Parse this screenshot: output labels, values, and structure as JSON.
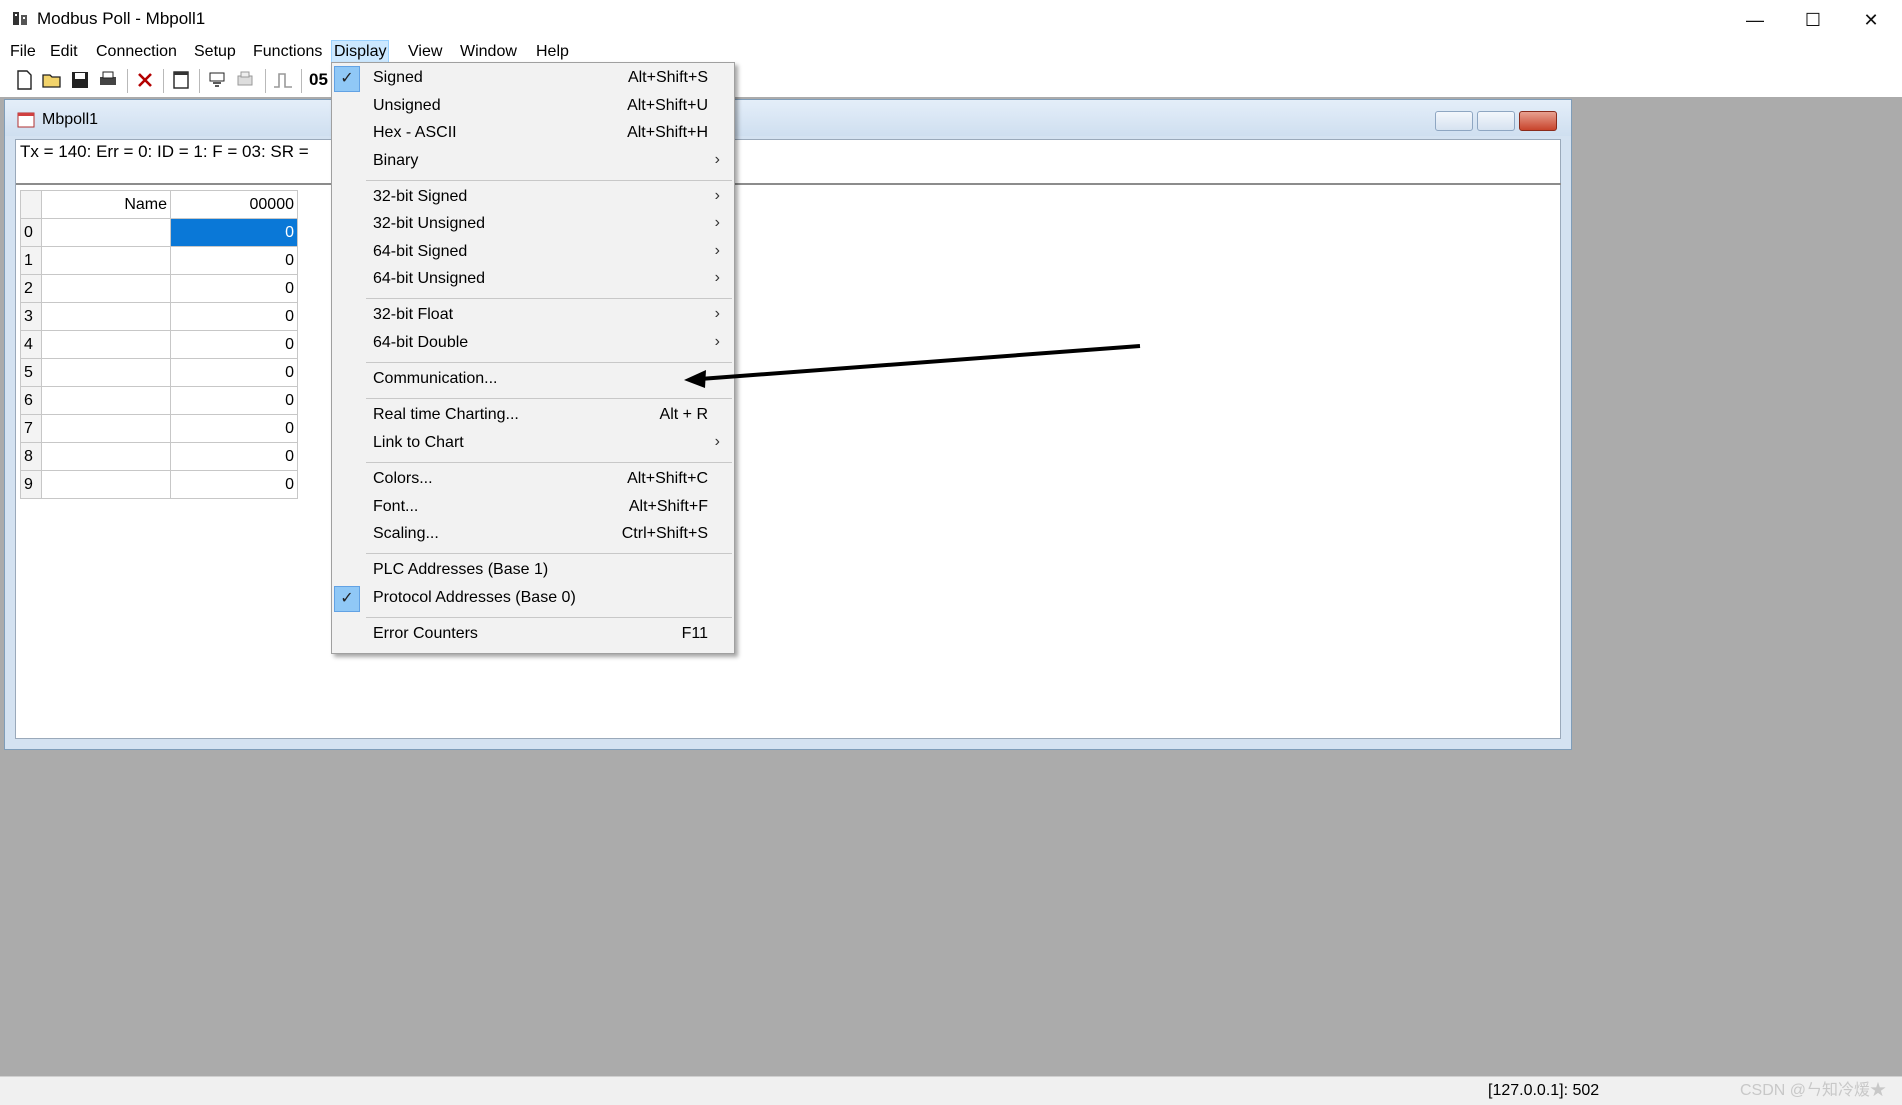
{
  "window": {
    "title": "Modbus Poll - Mbpoll1",
    "controls": {
      "minimize": "—",
      "maximize": "☐",
      "close": "✕"
    }
  },
  "menubar": {
    "items": [
      "File",
      "Edit",
      "Connection",
      "Setup",
      "Functions",
      "Display",
      "View",
      "Window",
      "Help"
    ],
    "active": "Display"
  },
  "toolbar": {
    "text_label": "05",
    "icons": [
      "new-icon",
      "open-icon",
      "save-icon",
      "print-icon",
      "delete-icon",
      "window-icon",
      "read-icon",
      "write-icon",
      "pulse-icon"
    ]
  },
  "child_window": {
    "title": "Mbpoll1",
    "status_line": "Tx = 140: Err = 0: ID = 1: F = 03: SR ="
  },
  "grid": {
    "headers": {
      "name": "Name",
      "address": "00000"
    },
    "rows": [
      {
        "index": "0",
        "name": "",
        "value": "0",
        "selected": true
      },
      {
        "index": "1",
        "name": "",
        "value": "0"
      },
      {
        "index": "2",
        "name": "",
        "value": "0"
      },
      {
        "index": "3",
        "name": "",
        "value": "0"
      },
      {
        "index": "4",
        "name": "",
        "value": "0"
      },
      {
        "index": "5",
        "name": "",
        "value": "0"
      },
      {
        "index": "6",
        "name": "",
        "value": "0"
      },
      {
        "index": "7",
        "name": "",
        "value": "0"
      },
      {
        "index": "8",
        "name": "",
        "value": "0"
      },
      {
        "index": "9",
        "name": "",
        "value": "0"
      }
    ]
  },
  "display_menu": {
    "items": [
      {
        "label": "Signed",
        "shortcut": "Alt+Shift+S",
        "checked": true
      },
      {
        "label": "Unsigned",
        "shortcut": "Alt+Shift+U"
      },
      {
        "label": "Hex - ASCII",
        "shortcut": "Alt+Shift+H"
      },
      {
        "label": "Binary",
        "submenu": true
      },
      {
        "label": "32-bit Signed",
        "submenu": true
      },
      {
        "label": "32-bit Unsigned",
        "submenu": true
      },
      {
        "label": "64-bit Signed",
        "submenu": true
      },
      {
        "label": "64-bit Unsigned",
        "submenu": true
      },
      {
        "label": "32-bit Float",
        "submenu": true
      },
      {
        "label": "64-bit Double",
        "submenu": true
      },
      {
        "label": "Communication..."
      },
      {
        "label": "Real time Charting...",
        "shortcut": "Alt + R"
      },
      {
        "label": "Link to Chart",
        "submenu": true
      },
      {
        "label": "Colors...",
        "shortcut": "Alt+Shift+C"
      },
      {
        "label": "Font...",
        "shortcut": "Alt+Shift+F"
      },
      {
        "label": "Scaling...",
        "shortcut": "Ctrl+Shift+S"
      },
      {
        "label": "PLC Addresses (Base 1)"
      },
      {
        "label": "Protocol Addresses (Base 0)",
        "checked": true
      },
      {
        "label": "Error Counters",
        "shortcut": "F11"
      }
    ],
    "check_glyph": "✓",
    "submenu_glyph": "›"
  },
  "statusbar": {
    "connection": "[127.0.0.1]: 502",
    "watermark": "CSDN @ㄣ知冷煖★"
  },
  "colors": {
    "selection": "#0a78d7",
    "menu_highlight": "#cce8ff",
    "check_background": "#90c8f6"
  }
}
